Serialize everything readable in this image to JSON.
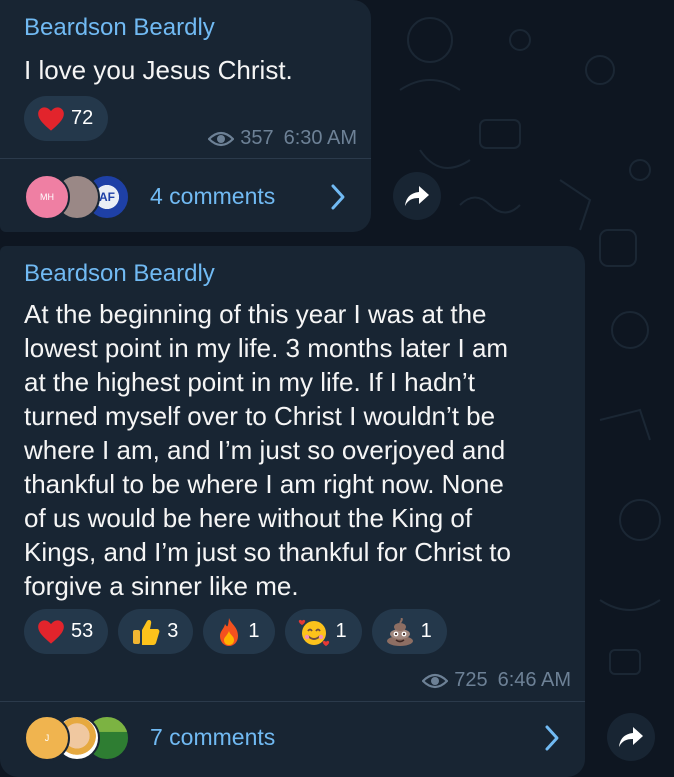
{
  "posts": [
    {
      "author": "Beardson Beardly",
      "text": "I love you Jesus Christ.",
      "reactions": [
        {
          "emoji": "red-heart",
          "count": "72"
        }
      ],
      "views": "357",
      "time": "6:30 AM",
      "comment_avatars": [
        "MH",
        "",
        "AF"
      ],
      "comments_label": "4 comments"
    },
    {
      "author": "Beardson Beardly",
      "text_lines": [
        "At the beginning of this year I was at the",
        "lowest point in my life. 3 months later I am",
        "at the highest point in my life. If I hadn’t",
        "turned myself over to Christ I wouldn’t be",
        "where I am, and I’m just so overjoyed and",
        "thankful to be where I am right now. None",
        "of us would be here without the King of",
        "Kings, and I’m just so thankful for Christ to",
        "forgive a sinner like me."
      ],
      "reactions": [
        {
          "emoji": "red-heart",
          "count": "53"
        },
        {
          "emoji": "thumbs-up",
          "count": "3"
        },
        {
          "emoji": "fire",
          "count": "1"
        },
        {
          "emoji": "smiling-face-with-hearts",
          "count": "1"
        },
        {
          "emoji": "pile-of-poo",
          "count": "1"
        }
      ],
      "views": "725",
      "time": "6:46 AM",
      "comment_avatars": [
        "J",
        "",
        ""
      ],
      "comments_label": "7 comments"
    }
  ],
  "colors": {
    "background": "#0e1621",
    "bubble": "#182533",
    "author": "#71baf3",
    "reaction_pill": "#24384b",
    "meta": "#6d8196"
  },
  "icons": [
    "eye-icon",
    "chevron-right-icon",
    "share-arrow-icon"
  ]
}
